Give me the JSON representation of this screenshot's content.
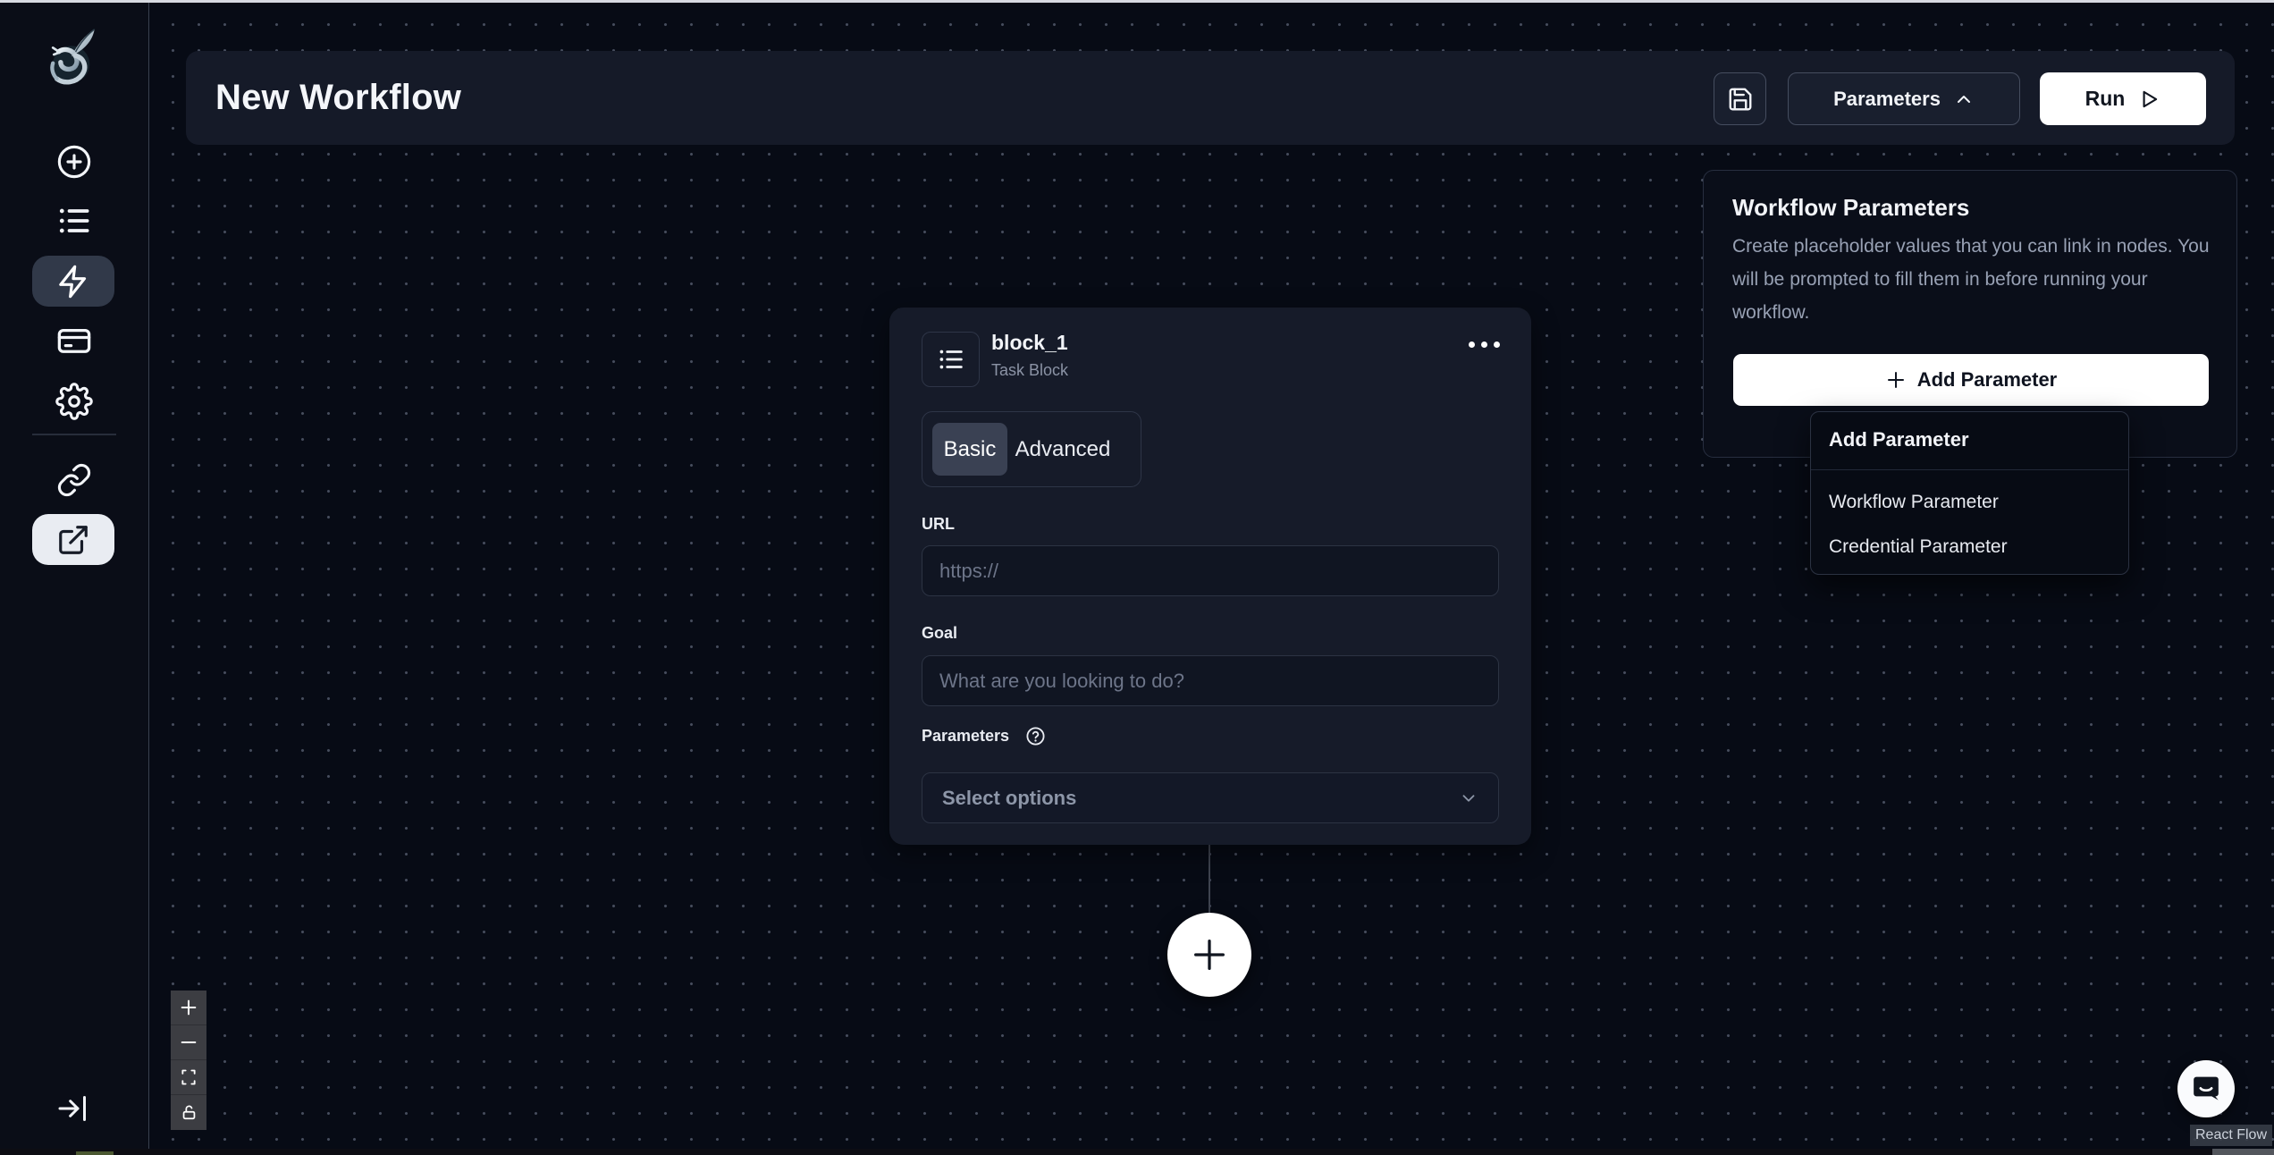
{
  "header": {
    "title": "New Workflow",
    "parameters_button": "Parameters",
    "run_button": "Run"
  },
  "block": {
    "name": "block_1",
    "type": "Task Block",
    "tabs": [
      "Basic",
      "Advanced"
    ],
    "active_tab": "Basic",
    "url_label": "URL",
    "url_placeholder": "https://",
    "goal_label": "Goal",
    "goal_placeholder": "What are you looking to do?",
    "parameters_label": "Parameters",
    "select_placeholder": "Select options"
  },
  "panel": {
    "title": "Workflow Parameters",
    "description": "Create placeholder values that you can link in nodes. You will be prompted to fill them in before running your workflow.",
    "add_button_label": "Add Parameter",
    "menu": {
      "header": "Add Parameter",
      "items": [
        "Workflow Parameter",
        "Credential Parameter"
      ]
    }
  },
  "attribution": {
    "label": "React Flow"
  },
  "icons": {
    "logo": "skyvern-dragon-logo",
    "sidebar": [
      "plus-circle",
      "list",
      "zap",
      "credit-card",
      "gear",
      "link",
      "external-link",
      "collapse-arrow"
    ],
    "header": [
      "save-floppy",
      "chevron-up",
      "play"
    ],
    "controls": [
      "zoom-in",
      "zoom-out",
      "fit-view",
      "lock-open"
    ],
    "misc": [
      "ellipsis",
      "help-circle",
      "chevron-down",
      "chat-bubble"
    ]
  },
  "colors": {
    "canvas_bg": "#070b15",
    "card_bg": "#161b29",
    "active_nav_dark": "#313949",
    "active_nav_light": "#e9ecf2",
    "active_tab": "#3a4153",
    "accent_white": "#ffffff"
  }
}
